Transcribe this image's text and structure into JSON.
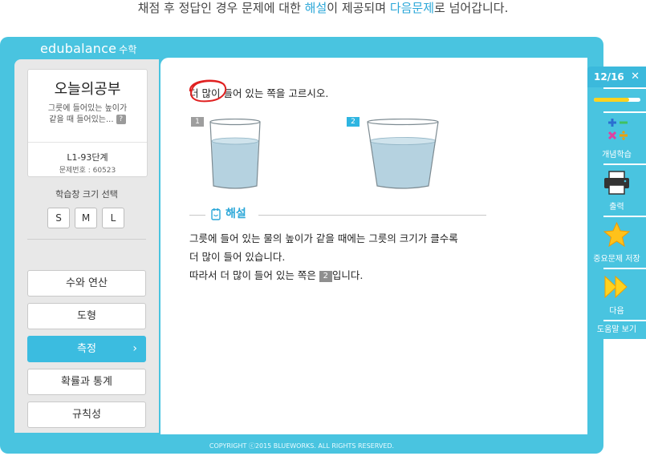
{
  "caption": {
    "part1": "채점 후 정답인 경우 문제에 대한 ",
    "highlight1": "해설",
    "part2": "이 제공되며 ",
    "highlight2": "다음문제",
    "part3": "로 넘어갑니다."
  },
  "app": {
    "logo": "edubalance",
    "logo_sub": "수학"
  },
  "card": {
    "title": "오늘의공부",
    "desc_line1": "그릇에 들어있는 높이가",
    "desc_line2": "같을 때 들어있는...",
    "help_mark": "?",
    "level": "L1-93단계",
    "problem_no": "문제번호 : 60523"
  },
  "size_select": {
    "label": "학습창 크기 선택",
    "options": [
      "S",
      "M",
      "L"
    ]
  },
  "menu": {
    "items": [
      {
        "label": "수와 연산"
      },
      {
        "label": "도형"
      },
      {
        "label": "측정",
        "active": true
      },
      {
        "label": "확률과 통계"
      },
      {
        "label": "규칙성"
      }
    ],
    "active_chevron": "›"
  },
  "question": {
    "text": "더 많이 들어 있는 쪽을 고르시오.",
    "cup1_label": "1",
    "cup2_label": "2"
  },
  "explanation": {
    "title": "해설",
    "line1": "그릇에 들어 있는 물의 높이가 같을 때에는 그릇의 크기가 클수록",
    "line2": "더 많이 들어 있습니다.",
    "line3_pre": "따라서 더 많이 들어 있는 쪽은 ",
    "answer": "2",
    "line3_post": "입니다."
  },
  "footer": {
    "copyright": "COPYRIGHT ⓒ2015 BLUEWORKS. ALL RIGHTS RESERVED."
  },
  "rightbar": {
    "counter": "12/16",
    "close": "✕",
    "progress": 0.75,
    "buttons": [
      {
        "label": "개념학습",
        "icon": "math-symbols-icon"
      },
      {
        "label": "출력",
        "icon": "printer-icon"
      },
      {
        "label": "중요문제 저장",
        "icon": "star-icon"
      },
      {
        "label": "다음",
        "icon": "double-arrow-icon"
      }
    ],
    "help": "도움말 보기"
  },
  "colors": {
    "frame": "#49c4e0",
    "accent": "#2ba7d8",
    "active_menu": "#3bbce0",
    "progress_fill": "#ffd21f",
    "water": "#b5d2e0"
  }
}
